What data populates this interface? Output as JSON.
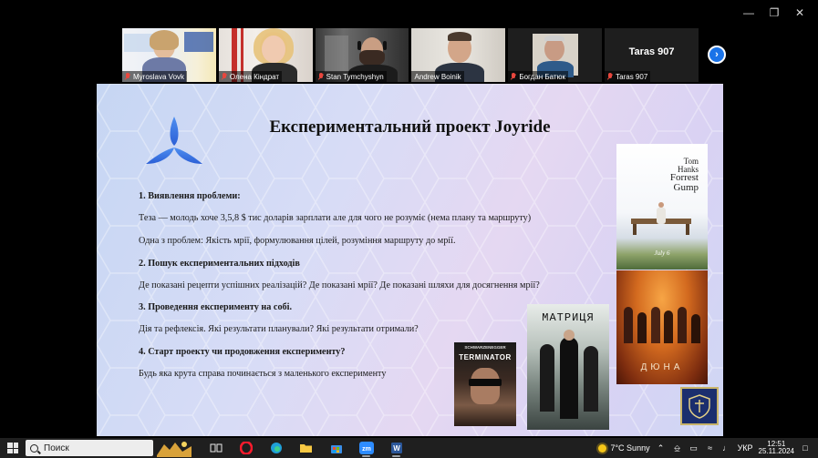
{
  "participants": [
    {
      "name": "Myroslava Vovk",
      "muted": true
    },
    {
      "name": "Олена Кіндрат",
      "muted": true
    },
    {
      "name": "Stan Tymchyshyn",
      "muted": true
    },
    {
      "name": "Andrew Boinik",
      "muted": false
    },
    {
      "name": "Богдан Батюк",
      "muted": true
    },
    {
      "name": "Taras 907",
      "muted": true,
      "video_off": true
    }
  ],
  "slide": {
    "title": "Експериментальний проект Joyride",
    "items": [
      {
        "heading": "1. Виявлення проблеми:",
        "paras": [
          "Теза — молодь хоче 3,5,8 $ тис доларів зарплати але для чого не розуміє (нема плану та маршруту)",
          "Одна з проблем: Якість мрії, формулювання цілей, розуміння маршруту до мрії."
        ]
      },
      {
        "heading": "2. Пошук експериментальних підходів",
        "paras": [
          "Де показані рецепти успішних реалізацій? Де показані мрії? Де показані шляхи для досягнення мрії?"
        ]
      },
      {
        "heading": "3. Проведення експерименту на собі.",
        "paras": [
          "Дія та рефлексія. Які результати планували? Які результати отримали?"
        ]
      },
      {
        "heading": "4.  Старт проекту чи продовження експерименту?",
        "paras": [
          "Будь яка крута справа починається з маленького експерименту"
        ]
      }
    ],
    "posters": {
      "forrest": {
        "line1": "Tom",
        "line2": "Hanks",
        "line3": "Forrest",
        "line4": "Gump",
        "date": "July 6"
      },
      "dune": {
        "title": "ДЮНА"
      },
      "matrix": {
        "title": "МАТРИЦЯ"
      },
      "terminator": {
        "top": "SCHWARZENEGGER",
        "title": "TERMINATOR"
      }
    }
  },
  "taskbar": {
    "search_placeholder": "Поиск",
    "weather": "7°C  Sunny",
    "language": "УКР",
    "time": "12:51",
    "date": "25.11.2024"
  },
  "colors": {
    "accent": "#1a73e8",
    "active_speaker": "#3ecf5e",
    "mute": "#e8473d"
  }
}
